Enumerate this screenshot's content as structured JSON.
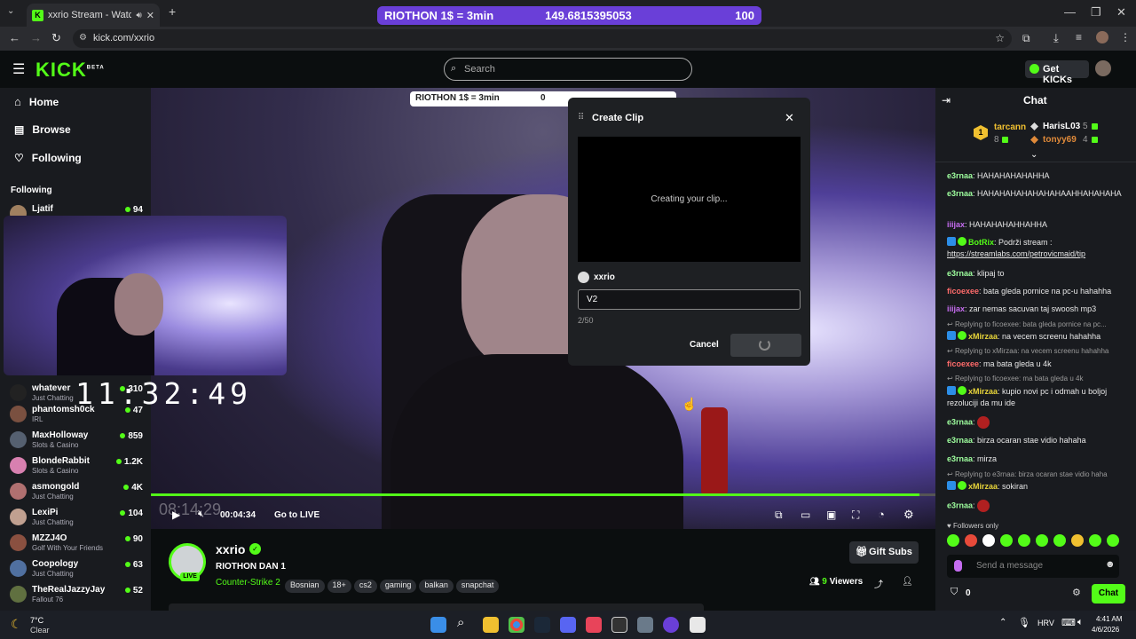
{
  "browser": {
    "tab_title": "xxrio Stream - Watch Live o",
    "url": "kick.com/xxrio",
    "top_overlay": {
      "label": "RIOTHON 1$ = 3min",
      "value": "149.6815395053",
      "goal": "100"
    }
  },
  "kick": {
    "logo": "KICK",
    "logo_badge": "BETA",
    "search_placeholder": "Search",
    "get_kicks": "Get KICKs"
  },
  "sidebar": {
    "nav": [
      {
        "label": "Home",
        "icon": "home-icon"
      },
      {
        "label": "Browse",
        "icon": "browse-icon"
      },
      {
        "label": "Following",
        "icon": "heart-icon"
      }
    ],
    "following_title": "Following",
    "channels": [
      {
        "name": "Ljatif",
        "category": "",
        "viewers": "94",
        "color": "#a08060"
      },
      {
        "name": "whatever",
        "category": "Just Chatting",
        "viewers": "310",
        "color": "#222222"
      },
      {
        "name": "phantomsh0ck",
        "category": "IRL",
        "viewers": "47",
        "color": "#7a5040"
      },
      {
        "name": "MaxHolloway",
        "category": "Slots & Casino",
        "viewers": "859",
        "color": "#556070"
      },
      {
        "name": "BlondeRabbit",
        "category": "Slots & Casino",
        "viewers": "1.2K",
        "color": "#d880b0"
      },
      {
        "name": "asmongold",
        "category": "Just Chatting",
        "viewers": "4K",
        "color": "#b07070"
      },
      {
        "name": "LexiPi",
        "category": "Just Chatting",
        "viewers": "104",
        "color": "#c0a090"
      },
      {
        "name": "MZZJ4O",
        "category": "Golf With Your Friends",
        "viewers": "90",
        "color": "#8a5040"
      },
      {
        "name": "Coopology",
        "category": "Just Chatting",
        "viewers": "63",
        "color": "#5070a0"
      },
      {
        "name": "TheRealJazzyJay",
        "category": "Fallout 76",
        "viewers": "52",
        "color": "#607040"
      }
    ]
  },
  "video": {
    "overlay_label": "RIOTHON 1$ = 3min",
    "overlay_value": "0",
    "clock": "11:32:49",
    "elapsed_ghost": "08:14:29",
    "elapsed": "00:04:34",
    "go_live": "Go to LIVE",
    "progress": 0.98
  },
  "clip": {
    "title": "Create Clip",
    "status": "Creating your clip...",
    "channel": "xxrio",
    "title_value": "V2",
    "counter": "2/50",
    "cancel": "Cancel"
  },
  "channel": {
    "name": "xxrio",
    "live": "LIVE",
    "stream_title": "RIOTHON DAN 1",
    "category": "Counter-Strike 2",
    "tags": [
      "Bosnian",
      "18+",
      "cs2",
      "gaming",
      "balkan",
      "snapchat"
    ],
    "gift_subs": "Gift Subs",
    "viewers": "9",
    "viewers_label": "Viewers"
  },
  "chat": {
    "title": "Chat",
    "leaders": [
      {
        "rank": "1",
        "name": "tarcann",
        "score": "8"
      },
      {
        "name": "HarisL03",
        "score": "5"
      },
      {
        "name": "tonyy69",
        "score": "4"
      }
    ],
    "messages": [
      {
        "user": "e3rnaa",
        "color": "#9eff9e",
        "text": "HAHAHAHAHAHHA"
      },
      {
        "user": "e3rnaa",
        "color": "#9eff9e",
        "text": "HAHAHAHAHAHAHAHAAHHAHAHAHA"
      },
      {
        "user": "iiijax",
        "color": "#c56cf0",
        "text": "HAHAHAHAHHAHHA"
      },
      {
        "user": "BotRix",
        "color": "#53fc18",
        "text": "Podrži stream :",
        "link": "https://streamlabs.com/petrovicmaid/tip"
      },
      {
        "user": "e3rnaa",
        "color": "#9eff9e",
        "text": "klipaj to"
      },
      {
        "user": "ficoexee",
        "color": "#ff6b6b",
        "text": "bata gleda pornice na pc-u hahahha"
      },
      {
        "user": "iiijax",
        "color": "#c56cf0",
        "text": "zar nemas sacuvan taj swoosh mp3"
      },
      {
        "reply": "Replying to ficoexee: bata gleda pornice na pc...",
        "user": "xMirzaa",
        "color": "#e8d53a",
        "text": "na vecem screenu hahahha"
      },
      {
        "reply": "Replying to xMirzaa: na vecem screenu hahahha",
        "user": "ficoexee",
        "color": "#ff6b6b",
        "text": "ma bata gleda u 4k"
      },
      {
        "reply": "Replying to ficoexee: ma bata gleda u 4k",
        "user": "xMirzaa",
        "color": "#e8d53a",
        "text": "kupio novi pc i odmah u boljoj rezoluciji da mu ide"
      },
      {
        "user": "e3rnaa",
        "color": "#9eff9e",
        "text": ""
      },
      {
        "user": "e3rnaa",
        "color": "#9eff9e",
        "text": "birza ocaran stae vidio hahaha"
      },
      {
        "user": "e3rnaa",
        "color": "#9eff9e",
        "text": "mirza"
      },
      {
        "reply": "Replying to e3rnaa: birza ocaran stae vidio haha",
        "user": "xMirzaa",
        "color": "#e8d53a",
        "text": "sokiran"
      },
      {
        "user": "e3rnaa",
        "color": "#9eff9e",
        "text": ""
      }
    ],
    "followers_only": "Followers only",
    "input_placeholder": "Send a message",
    "points": "0",
    "send": "Chat"
  },
  "taskbar": {
    "weather_temp": "7°C",
    "weather_desc": "Clear",
    "lang": "HRV",
    "time": "4:41 AM",
    "date": "4/6/2026"
  }
}
